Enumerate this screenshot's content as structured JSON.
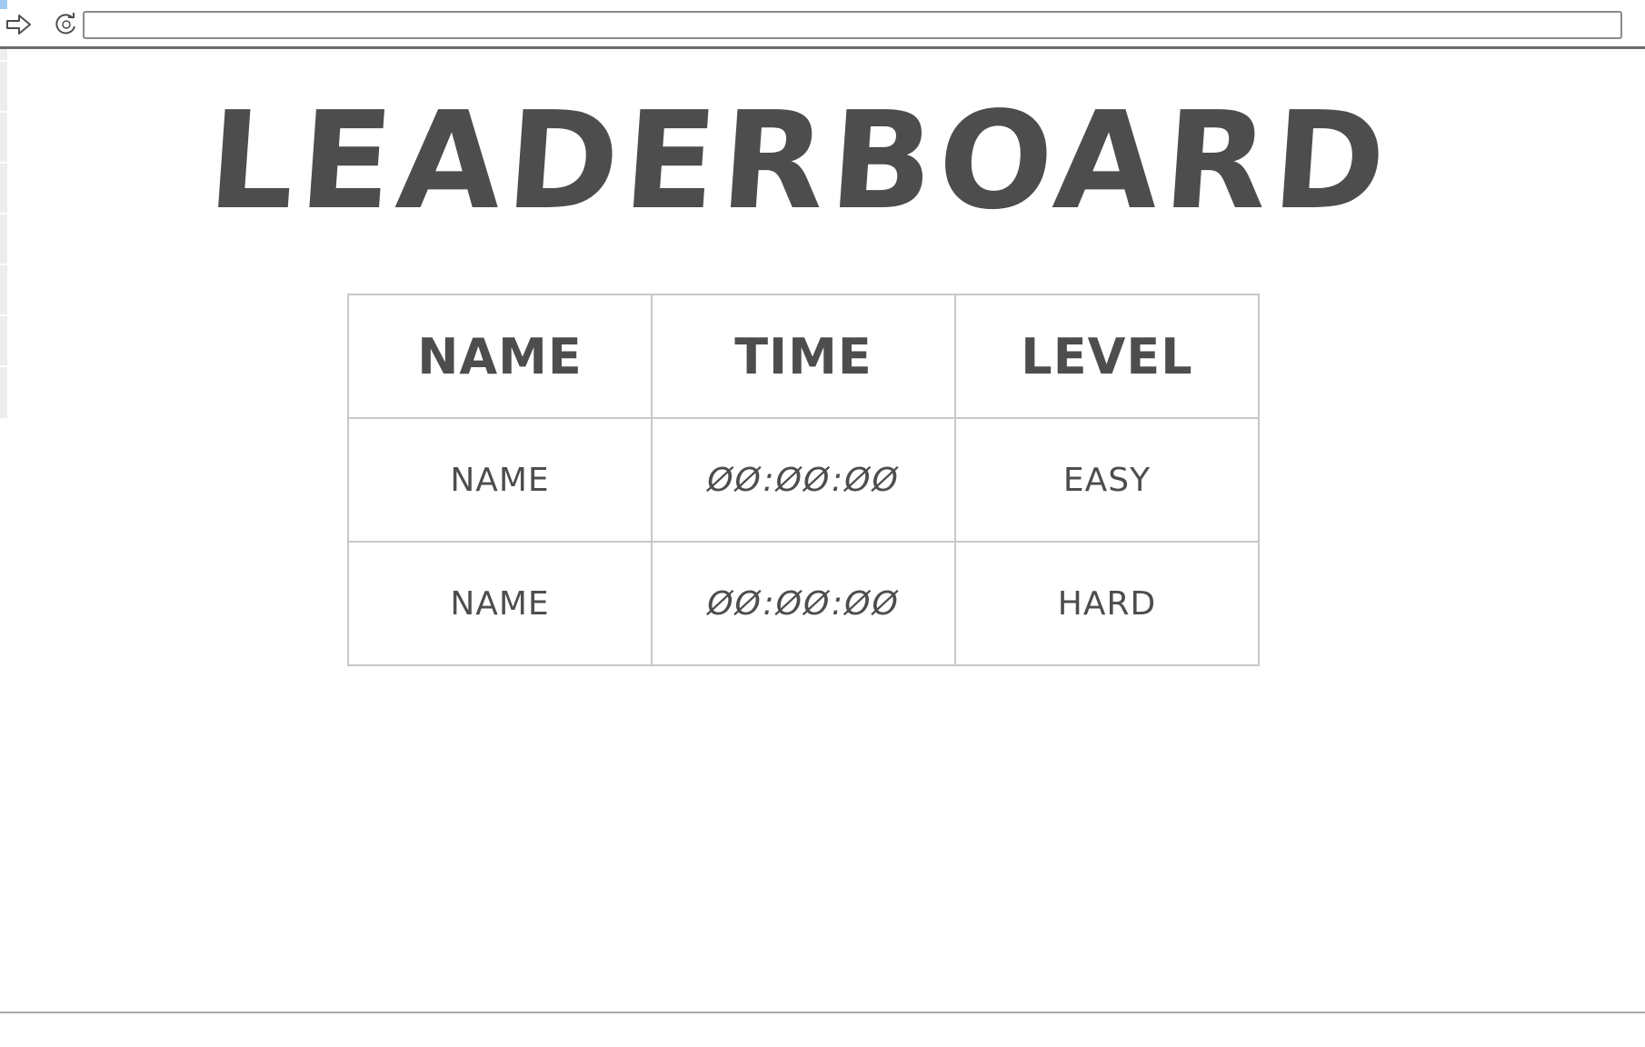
{
  "browser": {
    "forward_icon": "arrow-right-icon",
    "reload_icon": "reload-icon",
    "url_value": ""
  },
  "page": {
    "title": "LEADERBOARD"
  },
  "leaderboard": {
    "columns": [
      "NAME",
      "TIME",
      "LEVEL"
    ],
    "rows": [
      {
        "name": "NAME",
        "time": "ØØ:ØØ:ØØ",
        "level": "EASY"
      },
      {
        "name": "NAME",
        "time": "ØØ:ØØ:ØØ",
        "level": "HARD"
      }
    ]
  },
  "colors": {
    "text": "#4d4d4d",
    "grid": "#c8c8c8",
    "toolbar_border": "#6b6b6b",
    "accent": "#9ec9f0"
  }
}
